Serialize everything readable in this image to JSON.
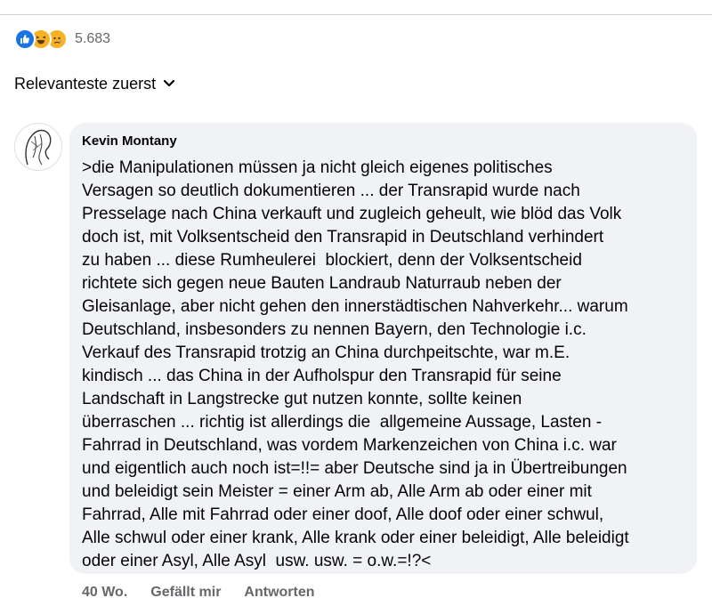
{
  "reactions": {
    "icons": [
      "like-icon",
      "haha-icon",
      "sad-icon"
    ],
    "count": "5.683",
    "colors": {
      "like": "#1b74e4",
      "emoji": "#f7b125"
    }
  },
  "sort": {
    "label": "Relevanteste zuerst",
    "icon": "chevron-down-icon"
  },
  "comment": {
    "author": "Kevin Montany",
    "text": ">die Manipulationen müssen ja nicht gleich eigenes politisches\nVersagen so deutlich dokumentieren ... der Transrapid wurde nach\nPresselage nach China verkauft und zugleich geheult, wie blöd das Volk\ndoch ist, mit Volksentscheid den Transrapid in Deutschland verhindert\nzu haben ... diese Rumheulerei  blockiert, denn der Volksentscheid\nrichtete sich gegen neue Bauten Landraub Naturraub neben der\nGleisanlage, aber nicht gehen den innerstädtischen Nahverkehr... warum\nDeutschland, insbesonders zu nennen Bayern, den Technologie i.c.\nVerkauf des Transrapid trotzig an China durchpeitschte, war m.E.\nkindisch ... das China in der Aufholspur den Transrapid für seine\nLandschaft in Langstrecke gut nutzen konnte, sollte keinen\nüberraschen ... richtig ist allerdings die  allgemeine Aussage, Lasten -\nFahrrad in Deutschland, was vordem Markenzeichen von China i.c. war\nund eigentlich auch noch ist=!!= aber Deutsche sind ja in Übertreibungen\nund beleidigt sein Meister = einer Arm ab, Alle Arm ab oder einer mit\nFahrrad, Alle mit Fahrrad oder einer doof, Alle doof oder einer schwul,\nAlle schwul oder einer krank, Alle krank oder einer beleidigt, Alle beleidigt\noder einer Asyl, Alle Asyl  usw. usw. = o.w.=!?<",
    "actions": {
      "time": "40 Wo.",
      "like": "Gefällt mir",
      "reply": "Antworten"
    }
  }
}
